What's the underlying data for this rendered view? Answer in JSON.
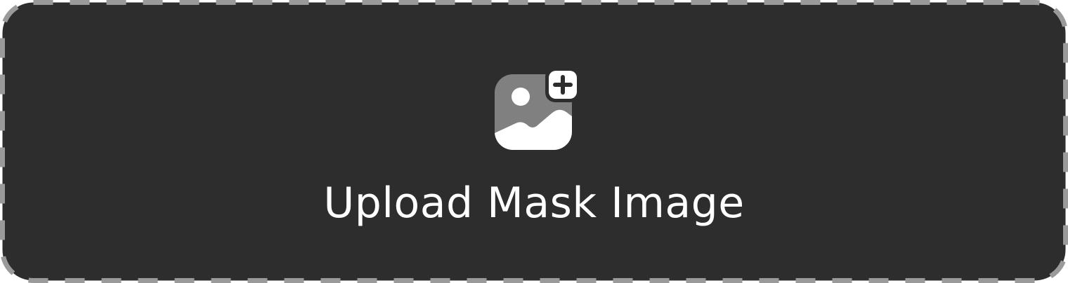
{
  "upload": {
    "label": "Upload Mask Image",
    "icon": "image-add-icon"
  },
  "colors": {
    "background": "#2d2d2d",
    "border": "#9a9a9a",
    "icon_fill": "#808080",
    "text": "#ffffff"
  }
}
